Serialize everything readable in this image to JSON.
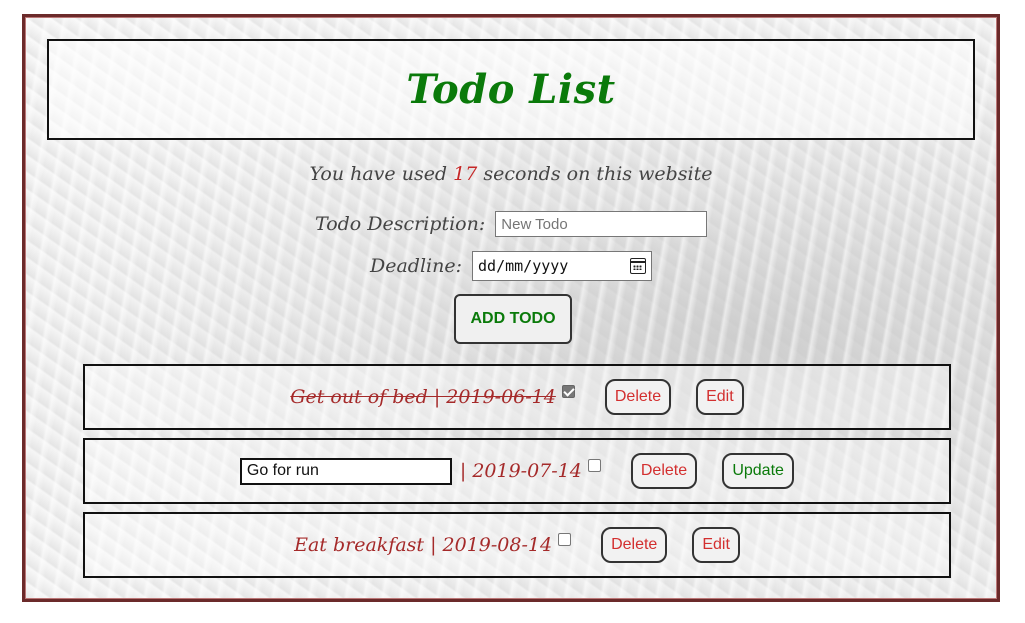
{
  "header": {
    "title": "Todo List"
  },
  "timer": {
    "prefix": "You have used ",
    "count": "17",
    "suffix": " seconds on this website"
  },
  "form": {
    "description_label": "Todo Description:",
    "description_placeholder": "New Todo",
    "deadline_label": "Deadline:",
    "deadline_value": "dd/mm/yyyy",
    "add_button": "ADD TODO"
  },
  "todos": [
    {
      "text": "Get out of bed | 2019-06-14",
      "completed": true,
      "delete_label": "Delete",
      "edit_label": "Edit"
    },
    {
      "edit_value": "Go for run",
      "deadline": "| 2019-07-14",
      "completed": false,
      "delete_label": "Delete",
      "update_label": "Update"
    },
    {
      "text": "Eat breakfast | 2019-08-14",
      "completed": false,
      "delete_label": "Delete",
      "edit_label": "Edit"
    }
  ],
  "colors": {
    "title": "#0a7a0a",
    "todo_text": "#a52a2a",
    "delete": "#d32f2f",
    "update": "#0a7a0a",
    "frame_border": "#6b2a2a"
  }
}
